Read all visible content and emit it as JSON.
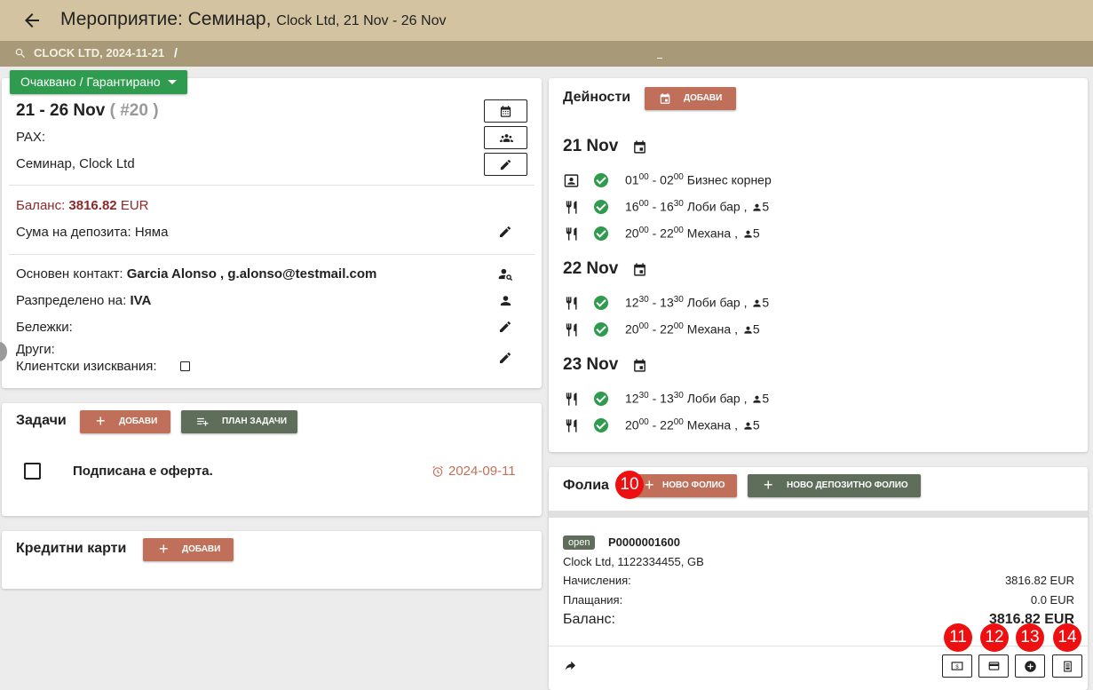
{
  "header": {
    "title": "Мероприятие: Семинар,",
    "subtitle": "Clock Ltd, 21 Nov - 26 Nov"
  },
  "breadcrumb": {
    "text": "CLOCK LTD, 2024-11-21",
    "separator": "/"
  },
  "event": {
    "status_label": "Очаквано / Гарантирано",
    "dates": "21 - 26 Nov",
    "number": "( #20 )",
    "pax_label": "PAX:",
    "name": "Семинар, Clock Ltd",
    "balance_label": "Баланс:",
    "balance_value": "3816.82",
    "balance_currency": "EUR",
    "deposit_label": "Сума на депозита:",
    "deposit_value": "Няма",
    "contact_label": "Основен контакт:",
    "contact_value": "Garcia Alonso , g.alonso@testmail.com",
    "assigned_label": "Разпределено на:",
    "assigned_value": "IVA",
    "notes_label": "Бележки:",
    "others_label": "Други:",
    "client_req_label": "Клиентски изисквания:"
  },
  "tasks": {
    "title": "Задачи",
    "add_label": "добави",
    "plan_label": "план задачи",
    "items": [
      {
        "text": "Подписана е оферта.",
        "date": "2024-09-11"
      }
    ]
  },
  "cards": {
    "title": "Кредитни карти",
    "add_label": "добави"
  },
  "activities": {
    "title": "Дейности",
    "add_label": "добави",
    "days": [
      {
        "date": "21 Nov",
        "items": [
          {
            "icon": "business-center-icon",
            "start_h": "01",
            "start_m": "00",
            "end_h": "02",
            "end_m": "00",
            "place": "Бизнес корнер",
            "pax": ""
          },
          {
            "icon": "restaurant-icon",
            "start_h": "16",
            "start_m": "00",
            "end_h": "16",
            "end_m": "30",
            "place": "Лоби бар ,",
            "pax": "5"
          },
          {
            "icon": "restaurant-icon",
            "start_h": "20",
            "start_m": "00",
            "end_h": "22",
            "end_m": "00",
            "place": "Механа ,",
            "pax": "5"
          }
        ]
      },
      {
        "date": "22 Nov",
        "items": [
          {
            "icon": "restaurant-icon",
            "start_h": "12",
            "start_m": "30",
            "end_h": "13",
            "end_m": "30",
            "place": "Лоби бар ,",
            "pax": "5"
          },
          {
            "icon": "restaurant-icon",
            "start_h": "20",
            "start_m": "00",
            "end_h": "22",
            "end_m": "00",
            "place": "Механа ,",
            "pax": "5"
          }
        ]
      },
      {
        "date": "23 Nov",
        "items": [
          {
            "icon": "restaurant-icon",
            "start_h": "12",
            "start_m": "30",
            "end_h": "13",
            "end_m": "30",
            "place": "Лоби бар ,",
            "pax": "5"
          },
          {
            "icon": "restaurant-icon",
            "start_h": "20",
            "start_m": "00",
            "end_h": "22",
            "end_m": "00",
            "place": "Механа ,",
            "pax": "5"
          }
        ]
      }
    ]
  },
  "folios": {
    "title": "Фолиа",
    "new_folio_label": "ново фолио",
    "new_deposit_label": "ново депозитно фолио",
    "folio": {
      "status": "open",
      "number": "P0000001600",
      "client": "Clock Ltd, 1122334455, GB",
      "charges_label": "Начисления:",
      "charges_value": "3816.82 EUR",
      "payments_label": "Плащания:",
      "payments_value": "0.0 EUR",
      "balance_label": "Баланс:",
      "balance_value": "3816.82 EUR"
    }
  },
  "markers": [
    "10",
    "11",
    "12",
    "13",
    "14"
  ],
  "colors": {
    "header_bg": "#d3c3a0",
    "breadcrumb_bg": "#a89a78",
    "status_green": "#2e9b4e",
    "button_rust": "#c0705a",
    "button_green": "#5f6e5a",
    "balance_red": "#8b2a2a",
    "marker_red": "#ee1010"
  }
}
